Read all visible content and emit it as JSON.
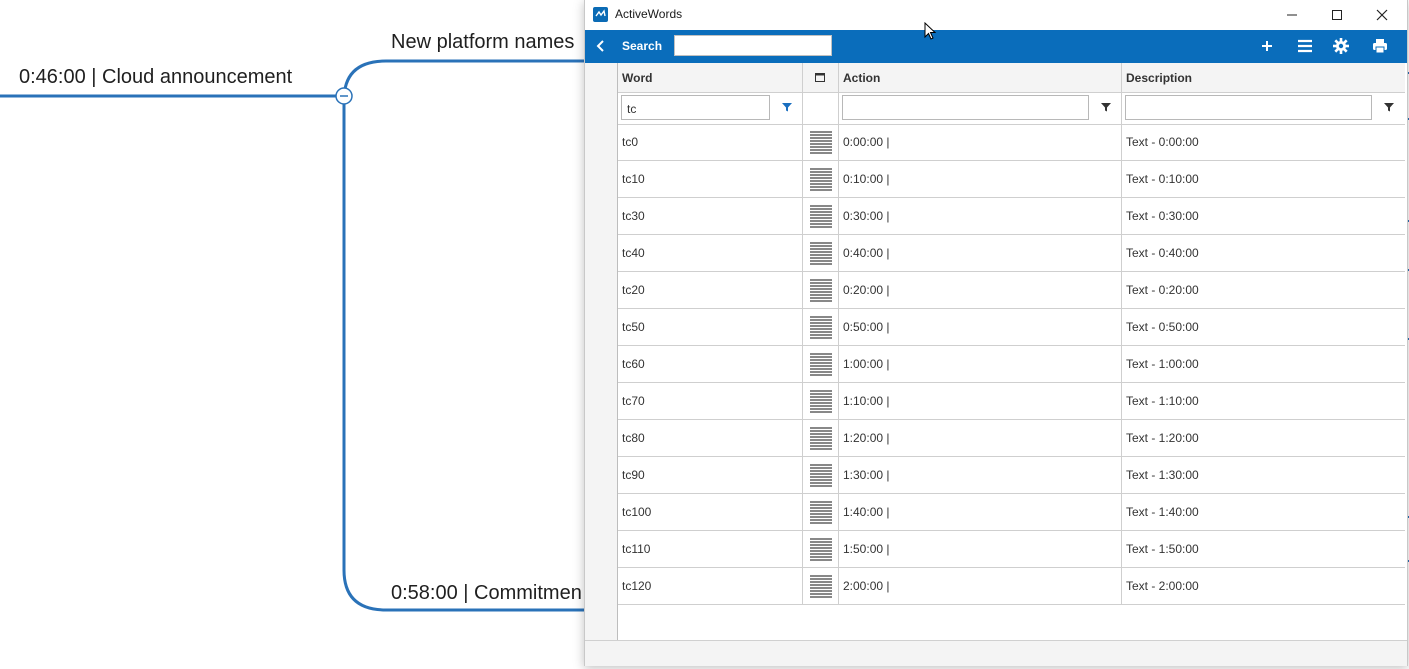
{
  "mindmap": {
    "node_top": "New platform names",
    "node_left": "0:46:00 |  Cloud announcement",
    "node_bottom": "0:58:00 |  Commitmen"
  },
  "window": {
    "title": "ActiveWords",
    "controls": [
      "minimize-icon",
      "maximize-icon",
      "close-icon"
    ]
  },
  "toolbar": {
    "search_label": "Search",
    "search_value": "",
    "icons": [
      "back-icon",
      "plus-icon",
      "menu-icon",
      "gear-icon",
      "print-icon"
    ]
  },
  "grid": {
    "headers": [
      "Word",
      "",
      "Action",
      "Description"
    ],
    "filters": {
      "word": "tc",
      "action": "",
      "description": ""
    },
    "rows": [
      {
        "word": "tc0",
        "action": "0:00:00 |",
        "description": "Text - 0:00:00"
      },
      {
        "word": "tc10",
        "action": "0:10:00 |",
        "description": "Text - 0:10:00"
      },
      {
        "word": "tc30",
        "action": "0:30:00 |",
        "description": "Text - 0:30:00"
      },
      {
        "word": "tc40",
        "action": "0:40:00 |",
        "description": "Text - 0:40:00"
      },
      {
        "word": "tc20",
        "action": "0:20:00 |",
        "description": "Text - 0:20:00"
      },
      {
        "word": "tc50",
        "action": "0:50:00 |",
        "description": "Text - 0:50:00"
      },
      {
        "word": "tc60",
        "action": "1:00:00 |",
        "description": "Text - 1:00:00"
      },
      {
        "word": "tc70",
        "action": "1:10:00 |",
        "description": "Text - 1:10:00"
      },
      {
        "word": "tc80",
        "action": "1:20:00 |",
        "description": "Text - 1:20:00"
      },
      {
        "word": "tc90",
        "action": "1:30:00 |",
        "description": "Text - 1:30:00"
      },
      {
        "word": "tc100",
        "action": "1:40:00 |",
        "description": "Text - 1:40:00"
      },
      {
        "word": "tc110",
        "action": "1:50:00 |",
        "description": "Text - 1:50:00"
      },
      {
        "word": "tc120",
        "action": "2:00:00 |",
        "description": "Text - 2:00:00"
      }
    ]
  },
  "colors": {
    "accent": "#0a6dbb",
    "mindmap_line": "#2a72b8"
  }
}
